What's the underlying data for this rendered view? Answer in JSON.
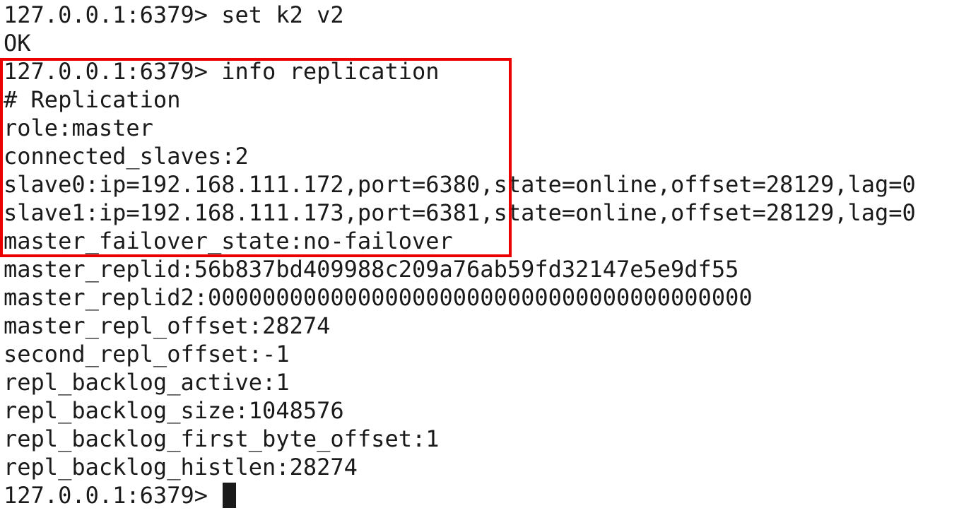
{
  "terminal": {
    "lines": [
      "127.0.0.1:6379> set k2 v2",
      "OK",
      "127.0.0.1:6379> info replication",
      "# Replication",
      "role:master",
      "connected_slaves:2",
      "slave0:ip=192.168.111.172,port=6380,state=online,offset=28129,lag=0",
      "slave1:ip=192.168.111.173,port=6381,state=online,offset=28129,lag=0",
      "master_failover_state:no-failover",
      "master_replid:56b837bd409988c209a76ab59fd32147e5e9df55",
      "master_replid2:0000000000000000000000000000000000000000",
      "master_repl_offset:28274",
      "second_repl_offset:-1",
      "repl_backlog_active:1",
      "repl_backlog_size:1048576",
      "repl_backlog_first_byte_offset:1",
      "repl_backlog_histlen:28274"
    ],
    "prompt": "127.0.0.1:6379> ",
    "highlight_color": "#ea0000",
    "text_color": "#1a1a1a",
    "background_color": "#ffffff"
  }
}
